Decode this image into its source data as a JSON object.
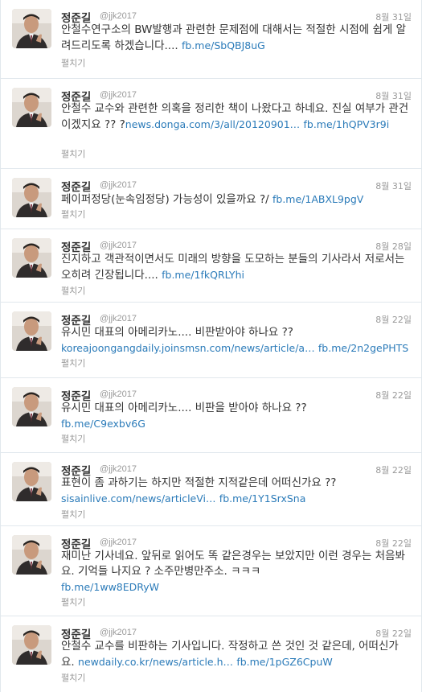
{
  "tweets": [
    {
      "name": "정준길",
      "handle": "@jjk2017",
      "date": "8월 31일",
      "text": "안철수연구소의 BW발행과 관련한 문제점에 대해서는 적절한 시점에 쉽게 알려드리도록 하겠습니다....",
      "links": [
        "fb.me/SbQBJ8uG"
      ],
      "expand": "펼치기"
    },
    {
      "name": "정준길",
      "handle": "@jjk2017",
      "date": "8월 31일",
      "text": "안철수 교수와 관련한 의혹을 정리한 책이 나왔다고 하네요. 진실 여부가 관건이겠지요 ?? ?",
      "links": [
        "news.donga.com/3/all/20120901…",
        "fb.me/1hQPV3r9i"
      ],
      "expand": "펼치기"
    },
    {
      "name": "정준길",
      "handle": "@jjk2017",
      "date": "8월 31일",
      "text": "페이퍼정당(눈속임정당) 가능성이 있을까요 ?/",
      "links": [
        "fb.me/1ABXL9pgV"
      ],
      "expand": "펼치기"
    },
    {
      "name": "정준길",
      "handle": "@jjk2017",
      "date": "8월 28일",
      "text": "진지하고 객관적이면서도 미래의 방향을 도모하는 분들의 기사라서 저로서는 오히려 긴장됩니다....",
      "links": [
        "fb.me/1fkQRLYhi"
      ],
      "expand": "펼치기"
    },
    {
      "name": "정준길",
      "handle": "@jjk2017",
      "date": "8월 22일",
      "text": "유시민 대표의 아메리카노.... 비판받아야 하나요 ??",
      "links": [
        "koreajoongangdaily.joinsmsn.com/news/article/a…",
        "fb.me/2n2gePHTS"
      ],
      "expand": "펼치기"
    },
    {
      "name": "정준길",
      "handle": "@jjk2017",
      "date": "8월 22일",
      "text": "유시민 대표의 아메리카노.... 비판을 받아야 하나요 ??",
      "links": [
        "fb.me/C9exbv6G"
      ],
      "expand": "펼치기"
    },
    {
      "name": "정준길",
      "handle": "@jjk2017",
      "date": "8월 22일",
      "text": "표현이 좀 과하기는 하지만 적절한 지적같은데 어떠신가요 ??",
      "links": [
        "sisainlive.com/news/articleVi…",
        "fb.me/1Y1SrxSna"
      ],
      "expand": "펼치기"
    },
    {
      "name": "정준길",
      "handle": "@jjk2017",
      "date": "8월 22일",
      "text": "재미난 기사네요. 앞뒤로 읽어도 똑 같은경우는 보았지만 이런 경우는 처음봐요. 기억들 나지요 ? 소주만병만주소. ㅋㅋㅋ",
      "links": [
        "fb.me/1ww8EDRyW"
      ],
      "expand": "펼치기"
    },
    {
      "name": "정준길",
      "handle": "@jjk2017",
      "date": "8월 22일",
      "text": "안철수 교수를 비판하는 기사입니다. 작정하고 쓴 것인 것 같은데, 어떠신가요.",
      "links": [
        "newdaily.co.kr/news/article.h…",
        "fb.me/1pGZ6CpuW"
      ],
      "expand": "펼치기"
    }
  ]
}
